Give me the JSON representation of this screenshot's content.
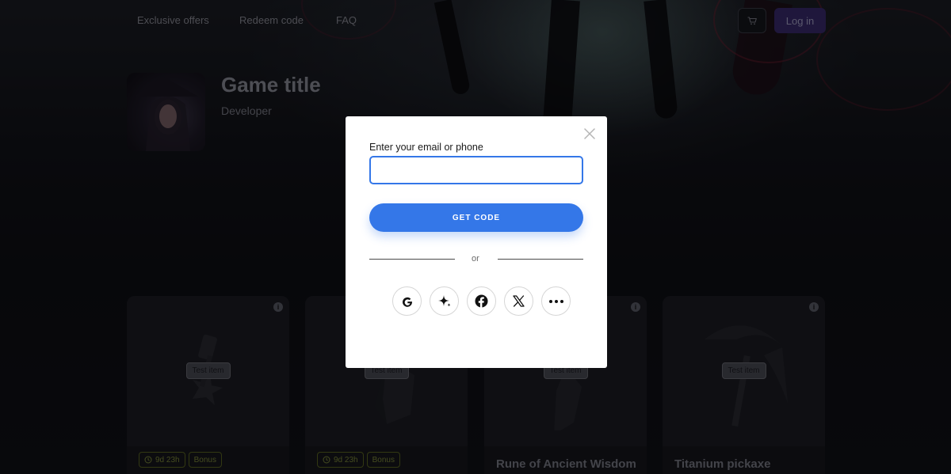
{
  "header": {
    "nav": [
      {
        "label": "Exclusive offers"
      },
      {
        "label": "Redeem code"
      },
      {
        "label": "FAQ"
      }
    ],
    "cart_icon": "cart-icon",
    "login_label": "Log in"
  },
  "game": {
    "title": "Game title",
    "developer": "Developer"
  },
  "items": [
    {
      "tag": "Test item",
      "badges": [
        "9d 23h",
        "Bonus"
      ],
      "name": ""
    },
    {
      "tag": "Test item",
      "badges": [
        "9d 23h",
        "Bonus"
      ],
      "name": ""
    },
    {
      "tag": "Test item",
      "badges": [],
      "name": "Rune of Ancient Wisdom"
    },
    {
      "tag": "Test item",
      "badges": [],
      "name": "Titanium pickaxe"
    }
  ],
  "modal": {
    "field_label": "Enter your email or phone",
    "input_value": "",
    "input_placeholder": "",
    "get_code_label": "GET CODE",
    "divider_text": "or",
    "social": [
      {
        "icon": "google-icon"
      },
      {
        "icon": "sparkle-icon"
      },
      {
        "icon": "facebook-icon"
      },
      {
        "icon": "x-icon"
      },
      {
        "icon": "more-icon"
      }
    ]
  },
  "colors": {
    "accent": "#3477e8",
    "login": "#3a2a6e",
    "badge": "#7e8a3a"
  }
}
